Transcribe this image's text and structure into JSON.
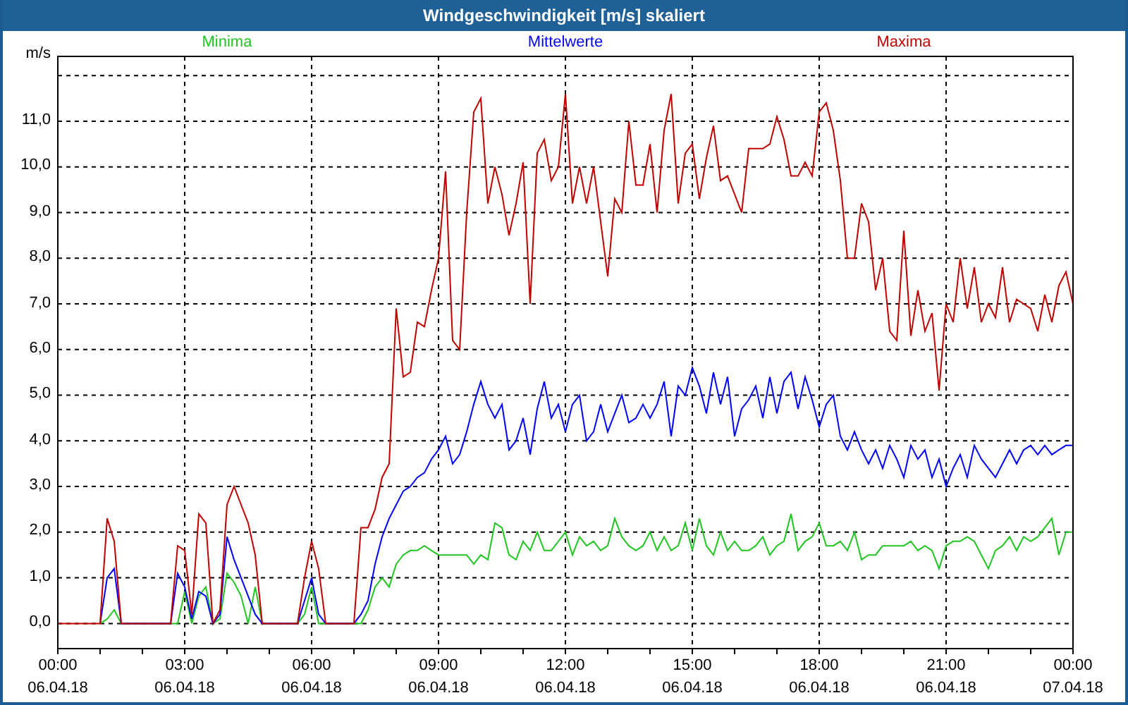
{
  "window": {
    "title": "Windgeschwindigkeit [m/s] skaliert"
  },
  "chart": {
    "chart_data": {
      "type": "line",
      "grid": true,
      "ylabel": "m/s",
      "categories": [
        "00:00 06.04.18",
        null,
        null,
        null,
        null,
        null,
        null,
        null,
        null,
        null,
        null,
        null,
        null,
        null,
        null,
        null,
        null,
        null,
        "03:00 06.04.18",
        null,
        null,
        null,
        null,
        null,
        null,
        null,
        null,
        null,
        null,
        null,
        null,
        null,
        null,
        null,
        null,
        null,
        "06:00 06.04.18",
        null,
        null,
        null,
        null,
        null,
        null,
        null,
        null,
        null,
        null,
        null,
        null,
        null,
        null,
        null,
        null,
        null,
        "09:00 06.04.18",
        null,
        null,
        null,
        null,
        null,
        null,
        null,
        null,
        null,
        null,
        null,
        null,
        null,
        null,
        null,
        null,
        null,
        "12:00 06.04.18",
        null,
        null,
        null,
        null,
        null,
        null,
        null,
        null,
        null,
        null,
        null,
        null,
        null,
        null,
        null,
        null,
        null,
        "15:00 06.04.18",
        null,
        null,
        null,
        null,
        null,
        null,
        null,
        null,
        null,
        null,
        null,
        null,
        null,
        null,
        null,
        null,
        null,
        "18:00 06.04.18",
        null,
        null,
        null,
        null,
        null,
        null,
        null,
        null,
        null,
        null,
        null,
        null,
        null,
        null,
        null,
        null,
        null,
        "21:00 06.04.18",
        null,
        null,
        null,
        null,
        null,
        null,
        null,
        null,
        null,
        null,
        null,
        null,
        null,
        null,
        null,
        null,
        null,
        "00:00 07.04.18"
      ],
      "series": [
        {
          "name": "Minima",
          "color": "#22c422",
          "values": [
            null,
            null,
            null,
            null,
            null,
            null,
            0,
            0.1,
            0.3,
            0,
            0,
            0,
            0,
            0,
            0,
            0,
            0,
            0,
            0.7,
            0,
            0.6,
            0.8,
            0,
            0.1,
            1.1,
            0.9,
            0.6,
            0,
            0.8,
            0,
            0,
            0,
            0,
            0,
            0,
            0.2,
            0.8,
            0,
            0,
            0,
            0,
            0,
            0,
            0,
            0.3,
            0.8,
            1.0,
            0.8,
            1.3,
            1.5,
            1.6,
            1.6,
            1.7,
            1.6,
            1.5,
            1.5,
            1.5,
            1.5,
            1.5,
            1.3,
            1.5,
            1.4,
            2.2,
            2.1,
            1.5,
            1.4,
            1.8,
            1.6,
            2.0,
            1.6,
            1.6,
            1.8,
            2.0,
            1.5,
            1.9,
            1.7,
            1.8,
            1.6,
            1.7,
            2.3,
            1.9,
            1.7,
            1.6,
            1.7,
            2.0,
            1.6,
            1.9,
            1.6,
            1.7,
            2.2,
            1.6,
            2.3,
            1.7,
            1.5,
            2.0,
            1.6,
            1.8,
            1.6,
            1.6,
            1.7,
            1.9,
            1.5,
            1.7,
            1.8,
            2.4,
            1.6,
            1.8,
            1.9,
            2.2,
            1.7,
            1.7,
            1.8,
            1.6,
            2.0,
            1.4,
            1.5,
            1.5,
            1.7,
            1.7,
            1.7,
            1.7,
            1.8,
            1.6,
            1.7,
            1.6,
            1.2,
            1.7,
            1.8,
            1.8,
            1.9,
            1.8,
            1.5,
            1.2,
            1.6,
            1.7,
            1.9,
            1.6,
            1.9,
            1.8,
            1.9,
            2.1,
            2.3,
            1.5,
            2.0,
            2.0
          ]
        },
        {
          "name": "Mittelwerte",
          "color": "#0000ff",
          "values": [
            null,
            null,
            null,
            null,
            null,
            null,
            0,
            1.0,
            1.2,
            0,
            0,
            0,
            0,
            0,
            0,
            0,
            0,
            1.1,
            0.8,
            0.1,
            0.7,
            0.6,
            0,
            0.2,
            1.9,
            1.4,
            1.0,
            0.6,
            0.2,
            0,
            0,
            0,
            0,
            0,
            0,
            0.5,
            1.0,
            0.2,
            0,
            0,
            0,
            0,
            0,
            0.2,
            0.5,
            1.3,
            1.9,
            2.3,
            2.6,
            2.9,
            3.0,
            3.2,
            3.3,
            3.6,
            3.8,
            4.1,
            3.5,
            3.7,
            4.2,
            4.8,
            5.3,
            4.8,
            4.5,
            4.8,
            3.8,
            4.0,
            4.5,
            3.7,
            4.7,
            5.3,
            4.5,
            4.8,
            4.2,
            4.8,
            5.0,
            4.0,
            4.2,
            4.8,
            4.2,
            4.6,
            5.0,
            4.4,
            4.5,
            4.8,
            4.5,
            4.8,
            5.3,
            4.1,
            5.2,
            5.0,
            5.6,
            5.2,
            4.6,
            5.5,
            4.8,
            5.4,
            4.1,
            4.7,
            4.9,
            5.2,
            4.5,
            5.4,
            4.6,
            5.3,
            5.5,
            4.7,
            5.4,
            4.9,
            4.3,
            4.8,
            5.0,
            4.1,
            3.8,
            4.2,
            3.8,
            3.5,
            3.8,
            3.4,
            3.9,
            3.6,
            3.2,
            3.9,
            3.6,
            3.8,
            3.2,
            3.6,
            3.0,
            3.4,
            3.7,
            3.2,
            3.9,
            3.6,
            3.4,
            3.2,
            3.5,
            3.8,
            3.5,
            3.8,
            3.9,
            3.7,
            3.9,
            3.7,
            3.8,
            3.9,
            3.9
          ]
        },
        {
          "name": "Maxima",
          "color": "#c00000",
          "values": [
            0,
            0,
            0,
            0,
            0,
            0,
            0,
            2.3,
            1.8,
            0,
            0,
            0,
            0,
            0,
            0,
            0,
            0,
            1.7,
            1.6,
            0.2,
            2.4,
            2.2,
            0,
            0.3,
            2.6,
            3.0,
            2.6,
            2.2,
            1.5,
            0,
            0,
            0,
            0,
            0,
            0,
            1.0,
            1.8,
            1.2,
            0,
            0,
            0,
            0,
            0,
            2.1,
            2.1,
            2.5,
            3.2,
            3.5,
            6.9,
            5.4,
            5.5,
            6.6,
            6.5,
            7.3,
            8.0,
            9.9,
            6.2,
            6.0,
            9.0,
            11.2,
            11.5,
            9.2,
            10.0,
            9.4,
            8.5,
            9.2,
            10.1,
            7.0,
            10.3,
            10.6,
            9.7,
            10.0,
            11.6,
            9.2,
            10.0,
            9.2,
            10.0,
            8.8,
            7.6,
            9.3,
            9.0,
            11.0,
            9.6,
            9.6,
            10.5,
            9.0,
            10.8,
            11.6,
            9.2,
            10.3,
            10.5,
            9.3,
            10.2,
            10.9,
            9.7,
            9.8,
            9.4,
            9.0,
            10.4,
            10.4,
            10.4,
            10.5,
            11.1,
            10.6,
            9.8,
            9.8,
            10.1,
            9.8,
            11.2,
            11.4,
            10.8,
            9.7,
            8.0,
            8.0,
            9.2,
            8.8,
            7.3,
            8.0,
            6.4,
            6.2,
            8.6,
            6.3,
            7.3,
            6.4,
            6.8,
            5.1,
            7.0,
            6.6,
            8.0,
            6.9,
            7.8,
            6.6,
            7.0,
            6.7,
            7.8,
            6.6,
            7.1,
            7.0,
            6.9,
            6.4,
            7.2,
            6.6,
            7.4,
            7.7,
            7.0
          ]
        }
      ],
      "ylim": [
        -0.55,
        12.42
      ],
      "yticks": [
        {
          "value": 0,
          "label": "0,0"
        },
        {
          "value": 1,
          "label": "1,0"
        },
        {
          "value": 2,
          "label": "2,0"
        },
        {
          "value": 3,
          "label": "3,0"
        },
        {
          "value": 4,
          "label": "4,0"
        },
        {
          "value": 5,
          "label": "5,0"
        },
        {
          "value": 6,
          "label": "6,0"
        },
        {
          "value": 7,
          "label": "7,0"
        },
        {
          "value": 8,
          "label": "8,0"
        },
        {
          "value": 9,
          "label": "9,0"
        },
        {
          "value": 10,
          "label": "10,0"
        },
        {
          "value": 11,
          "label": "11,0"
        }
      ]
    }
  }
}
